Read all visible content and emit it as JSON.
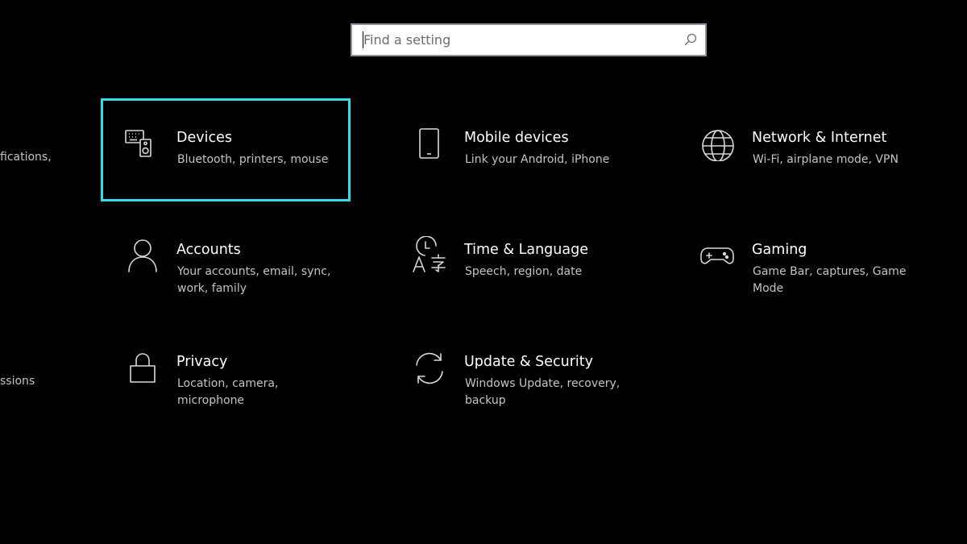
{
  "search": {
    "placeholder": "Find a setting",
    "value": ""
  },
  "clipped_left": [
    "fications,",
    "ssions"
  ],
  "tiles": [
    {
      "title": "Devices",
      "description": "Bluetooth, printers, mouse",
      "icon": "devices-icon",
      "focused": true
    },
    {
      "title": "Mobile devices",
      "description": "Link your Android, iPhone",
      "icon": "phone-icon",
      "focused": false
    },
    {
      "title": "Network & Internet",
      "description": "Wi-Fi, airplane mode, VPN",
      "icon": "globe-icon",
      "focused": false
    },
    {
      "title": "Accounts",
      "description": "Your accounts, email, sync, work, family",
      "icon": "person-icon",
      "focused": false
    },
    {
      "title": "Time & Language",
      "description": "Speech, region, date",
      "icon": "time-language-icon",
      "focused": false
    },
    {
      "title": "Gaming",
      "description": "Game Bar, captures, Game Mode",
      "icon": "gamepad-icon",
      "focused": false
    },
    {
      "title": "Privacy",
      "description": "Location, camera, microphone",
      "icon": "lock-icon",
      "focused": false
    },
    {
      "title": "Update & Security",
      "description": "Windows Update, recovery, backup",
      "icon": "sync-icon",
      "focused": false
    }
  ],
  "colors": {
    "background": "#000000",
    "focus_border": "#2fe0e6",
    "title_text": "#ffffff",
    "description_text": "#c3c3c3",
    "icon_stroke": "#d8d8d8"
  }
}
